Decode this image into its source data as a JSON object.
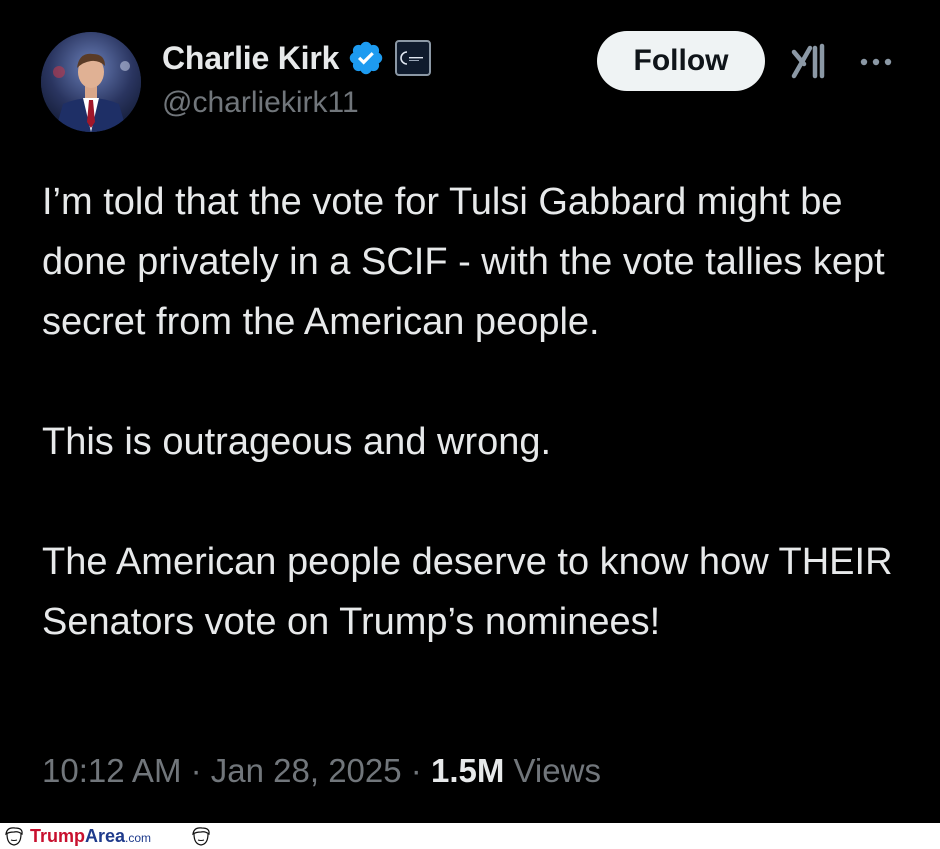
{
  "tweet": {
    "author": {
      "display_name": "Charlie Kirk",
      "handle": "@charliekirk11",
      "verified": true
    },
    "follow_label": "Follow",
    "body": [
      "I’m told that the vote for Tulsi Gabbard might be done privately in a SCIF - with the vote tallies kept secret from the American people.",
      "This is outrageous and wrong.",
      "The American people deserve to know how THEIR Senators vote on Trump’s nominees!"
    ],
    "meta": {
      "time": "10:12 AM",
      "separator": "·",
      "date": "Jan 28, 2025",
      "views_count": "1.5M",
      "views_label": "Views"
    },
    "icons": {
      "verified": "verified-badge-icon",
      "affiliate": "affiliate-badge-icon",
      "grok": "grok-icon",
      "more": "more-options-icon"
    },
    "colors": {
      "background": "#000000",
      "text": "#e7e9ea",
      "secondary_text": "#71767b",
      "verified_blue": "#1d9bf0",
      "follow_button_bg": "#eff3f4"
    }
  },
  "watermark": {
    "brand_part1": "Trump",
    "brand_part2": "Area",
    "brand_suffix": ".com",
    "colors": {
      "part1": "#c8102e",
      "part2": "#1f3b8c"
    }
  }
}
